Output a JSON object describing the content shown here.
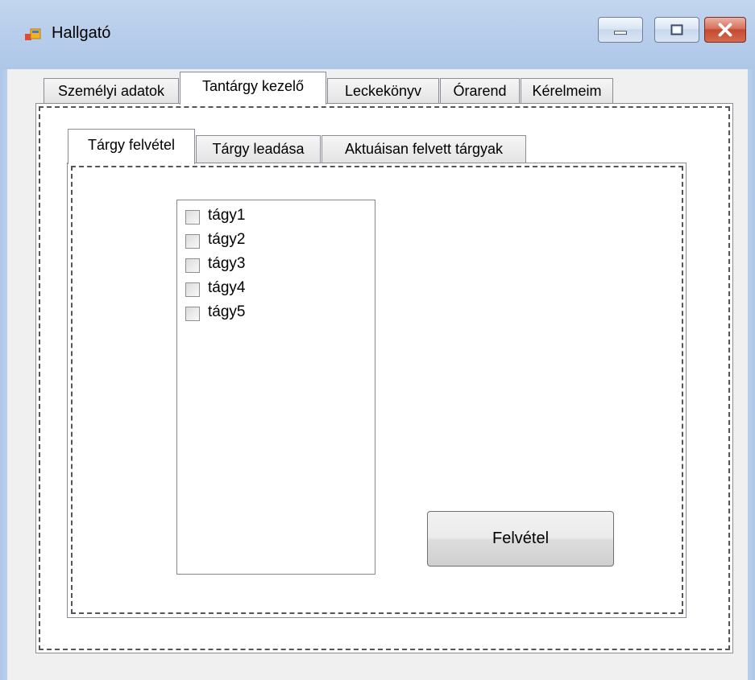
{
  "window": {
    "title": "Hallgató",
    "icon": "app-window-icon",
    "controls": [
      "minimize-icon",
      "maximize-icon",
      "close-icon"
    ]
  },
  "main_tabs": [
    {
      "label": "Személyi adatok",
      "active": false
    },
    {
      "label": "Tantárgy kezelő",
      "active": true
    },
    {
      "label": "Leckekönyv",
      "active": false
    },
    {
      "label": "Órarend",
      "active": false
    },
    {
      "label": "Kérelmeim",
      "active": false
    }
  ],
  "sub_tabs": [
    {
      "label": "Tárgy felvétel",
      "active": true
    },
    {
      "label": "Tárgy leadása",
      "active": false
    },
    {
      "label": "Aktuáisan felvett tárgyak",
      "active": false
    }
  ],
  "subject_list": [
    {
      "label": "tágy1",
      "checked": false
    },
    {
      "label": "tágy2",
      "checked": false
    },
    {
      "label": "tágy3",
      "checked": false
    },
    {
      "label": "tágy4",
      "checked": false
    },
    {
      "label": "tágy5",
      "checked": false
    }
  ],
  "actions": {
    "enroll_label": "Felvétel"
  },
  "colors": {
    "titlebar": "#b9cfec",
    "client": "#f0f0f0",
    "close_button": "#c44a30"
  }
}
